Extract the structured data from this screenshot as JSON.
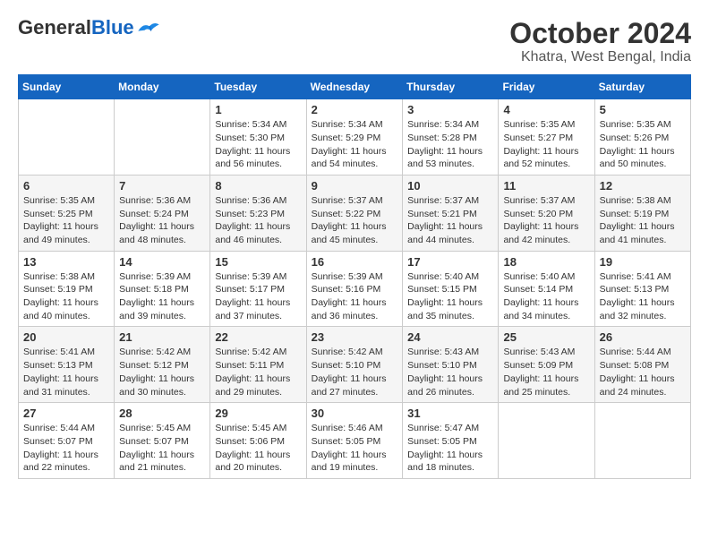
{
  "header": {
    "logo_general": "General",
    "logo_blue": "Blue",
    "title": "October 2024",
    "subtitle": "Khatra, West Bengal, India"
  },
  "calendar": {
    "columns": [
      "Sunday",
      "Monday",
      "Tuesday",
      "Wednesday",
      "Thursday",
      "Friday",
      "Saturday"
    ],
    "weeks": [
      [
        {
          "day": "",
          "info": ""
        },
        {
          "day": "",
          "info": ""
        },
        {
          "day": "1",
          "info": "Sunrise: 5:34 AM\nSunset: 5:30 PM\nDaylight: 11 hours and 56 minutes."
        },
        {
          "day": "2",
          "info": "Sunrise: 5:34 AM\nSunset: 5:29 PM\nDaylight: 11 hours and 54 minutes."
        },
        {
          "day": "3",
          "info": "Sunrise: 5:34 AM\nSunset: 5:28 PM\nDaylight: 11 hours and 53 minutes."
        },
        {
          "day": "4",
          "info": "Sunrise: 5:35 AM\nSunset: 5:27 PM\nDaylight: 11 hours and 52 minutes."
        },
        {
          "day": "5",
          "info": "Sunrise: 5:35 AM\nSunset: 5:26 PM\nDaylight: 11 hours and 50 minutes."
        }
      ],
      [
        {
          "day": "6",
          "info": "Sunrise: 5:35 AM\nSunset: 5:25 PM\nDaylight: 11 hours and 49 minutes."
        },
        {
          "day": "7",
          "info": "Sunrise: 5:36 AM\nSunset: 5:24 PM\nDaylight: 11 hours and 48 minutes."
        },
        {
          "day": "8",
          "info": "Sunrise: 5:36 AM\nSunset: 5:23 PM\nDaylight: 11 hours and 46 minutes."
        },
        {
          "day": "9",
          "info": "Sunrise: 5:37 AM\nSunset: 5:22 PM\nDaylight: 11 hours and 45 minutes."
        },
        {
          "day": "10",
          "info": "Sunrise: 5:37 AM\nSunset: 5:21 PM\nDaylight: 11 hours and 44 minutes."
        },
        {
          "day": "11",
          "info": "Sunrise: 5:37 AM\nSunset: 5:20 PM\nDaylight: 11 hours and 42 minutes."
        },
        {
          "day": "12",
          "info": "Sunrise: 5:38 AM\nSunset: 5:19 PM\nDaylight: 11 hours and 41 minutes."
        }
      ],
      [
        {
          "day": "13",
          "info": "Sunrise: 5:38 AM\nSunset: 5:19 PM\nDaylight: 11 hours and 40 minutes."
        },
        {
          "day": "14",
          "info": "Sunrise: 5:39 AM\nSunset: 5:18 PM\nDaylight: 11 hours and 39 minutes."
        },
        {
          "day": "15",
          "info": "Sunrise: 5:39 AM\nSunset: 5:17 PM\nDaylight: 11 hours and 37 minutes."
        },
        {
          "day": "16",
          "info": "Sunrise: 5:39 AM\nSunset: 5:16 PM\nDaylight: 11 hours and 36 minutes."
        },
        {
          "day": "17",
          "info": "Sunrise: 5:40 AM\nSunset: 5:15 PM\nDaylight: 11 hours and 35 minutes."
        },
        {
          "day": "18",
          "info": "Sunrise: 5:40 AM\nSunset: 5:14 PM\nDaylight: 11 hours and 34 minutes."
        },
        {
          "day": "19",
          "info": "Sunrise: 5:41 AM\nSunset: 5:13 PM\nDaylight: 11 hours and 32 minutes."
        }
      ],
      [
        {
          "day": "20",
          "info": "Sunrise: 5:41 AM\nSunset: 5:13 PM\nDaylight: 11 hours and 31 minutes."
        },
        {
          "day": "21",
          "info": "Sunrise: 5:42 AM\nSunset: 5:12 PM\nDaylight: 11 hours and 30 minutes."
        },
        {
          "day": "22",
          "info": "Sunrise: 5:42 AM\nSunset: 5:11 PM\nDaylight: 11 hours and 29 minutes."
        },
        {
          "day": "23",
          "info": "Sunrise: 5:42 AM\nSunset: 5:10 PM\nDaylight: 11 hours and 27 minutes."
        },
        {
          "day": "24",
          "info": "Sunrise: 5:43 AM\nSunset: 5:10 PM\nDaylight: 11 hours and 26 minutes."
        },
        {
          "day": "25",
          "info": "Sunrise: 5:43 AM\nSunset: 5:09 PM\nDaylight: 11 hours and 25 minutes."
        },
        {
          "day": "26",
          "info": "Sunrise: 5:44 AM\nSunset: 5:08 PM\nDaylight: 11 hours and 24 minutes."
        }
      ],
      [
        {
          "day": "27",
          "info": "Sunrise: 5:44 AM\nSunset: 5:07 PM\nDaylight: 11 hours and 22 minutes."
        },
        {
          "day": "28",
          "info": "Sunrise: 5:45 AM\nSunset: 5:07 PM\nDaylight: 11 hours and 21 minutes."
        },
        {
          "day": "29",
          "info": "Sunrise: 5:45 AM\nSunset: 5:06 PM\nDaylight: 11 hours and 20 minutes."
        },
        {
          "day": "30",
          "info": "Sunrise: 5:46 AM\nSunset: 5:05 PM\nDaylight: 11 hours and 19 minutes."
        },
        {
          "day": "31",
          "info": "Sunrise: 5:47 AM\nSunset: 5:05 PM\nDaylight: 11 hours and 18 minutes."
        },
        {
          "day": "",
          "info": ""
        },
        {
          "day": "",
          "info": ""
        }
      ]
    ]
  }
}
